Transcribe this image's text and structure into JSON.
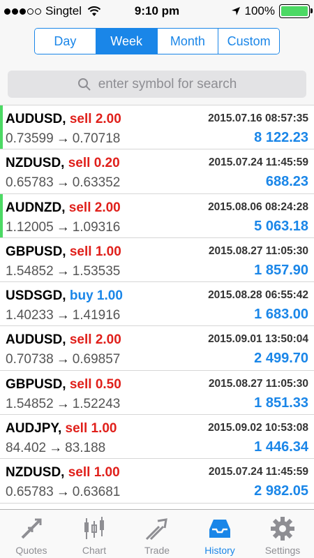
{
  "status_bar": {
    "carrier": "Singtel",
    "time": "9:10 pm",
    "battery": "100%"
  },
  "periods": [
    "Day",
    "Week",
    "Month",
    "Custom"
  ],
  "active_period": "Week",
  "search": {
    "placeholder": "enter symbol for search"
  },
  "trades": [
    {
      "symbol": "AUDUSD,",
      "action": "sell 2.00",
      "side": "sell",
      "open_price": "0.73599",
      "close_price": "0.70718",
      "date": "2015.07.16 08:57:35",
      "profit": "8 122.23",
      "marked": true
    },
    {
      "symbol": "NZDUSD,",
      "action": "sell 0.20",
      "side": "sell",
      "open_price": "0.65783",
      "close_price": "0.63352",
      "date": "2015.07.24 11:45:59",
      "profit": "688.23",
      "marked": false
    },
    {
      "symbol": "AUDNZD,",
      "action": "sell 2.00",
      "side": "sell",
      "open_price": "1.12005",
      "close_price": "1.09316",
      "date": "2015.08.06 08:24:28",
      "profit": "5 063.18",
      "marked": true
    },
    {
      "symbol": "GBPUSD,",
      "action": "sell 1.00",
      "side": "sell",
      "open_price": "1.54852",
      "close_price": "1.53535",
      "date": "2015.08.27 11:05:30",
      "profit": "1 857.90",
      "marked": false
    },
    {
      "symbol": "USDSGD,",
      "action": "buy 1.00",
      "side": "buy",
      "open_price": "1.40233",
      "close_price": "1.41916",
      "date": "2015.08.28 06:55:42",
      "profit": "1 683.00",
      "marked": false
    },
    {
      "symbol": "AUDUSD,",
      "action": "sell 2.00",
      "side": "sell",
      "open_price": "0.70738",
      "close_price": "0.69857",
      "date": "2015.09.01 13:50:04",
      "profit": "2 499.70",
      "marked": false
    },
    {
      "symbol": "GBPUSD,",
      "action": "sell 0.50",
      "side": "sell",
      "open_price": "1.54852",
      "close_price": "1.52243",
      "date": "2015.08.27 11:05:30",
      "profit": "1 851.33",
      "marked": false
    },
    {
      "symbol": "AUDJPY,",
      "action": "sell 1.00",
      "side": "sell",
      "open_price": "84.402",
      "close_price": "83.188",
      "date": "2015.09.02 10:53:08",
      "profit": "1 446.34",
      "marked": false
    },
    {
      "symbol": "NZDUSD,",
      "action": "sell 1.00",
      "side": "sell",
      "open_price": "0.65783",
      "close_price": "0.63681",
      "date": "2015.07.24 11:45:59",
      "profit": "2 982.05",
      "marked": false
    }
  ],
  "tabs": [
    {
      "label": "Quotes",
      "icon": "quotes-icon"
    },
    {
      "label": "Chart",
      "icon": "chart-icon"
    },
    {
      "label": "Trade",
      "icon": "trade-icon"
    },
    {
      "label": "History",
      "icon": "history-icon"
    },
    {
      "label": "Settings",
      "icon": "settings-icon"
    }
  ],
  "active_tab": "History",
  "colors": {
    "accent": "#1a86e8",
    "sell": "#e0201b",
    "open_marker": "#4cd964"
  }
}
